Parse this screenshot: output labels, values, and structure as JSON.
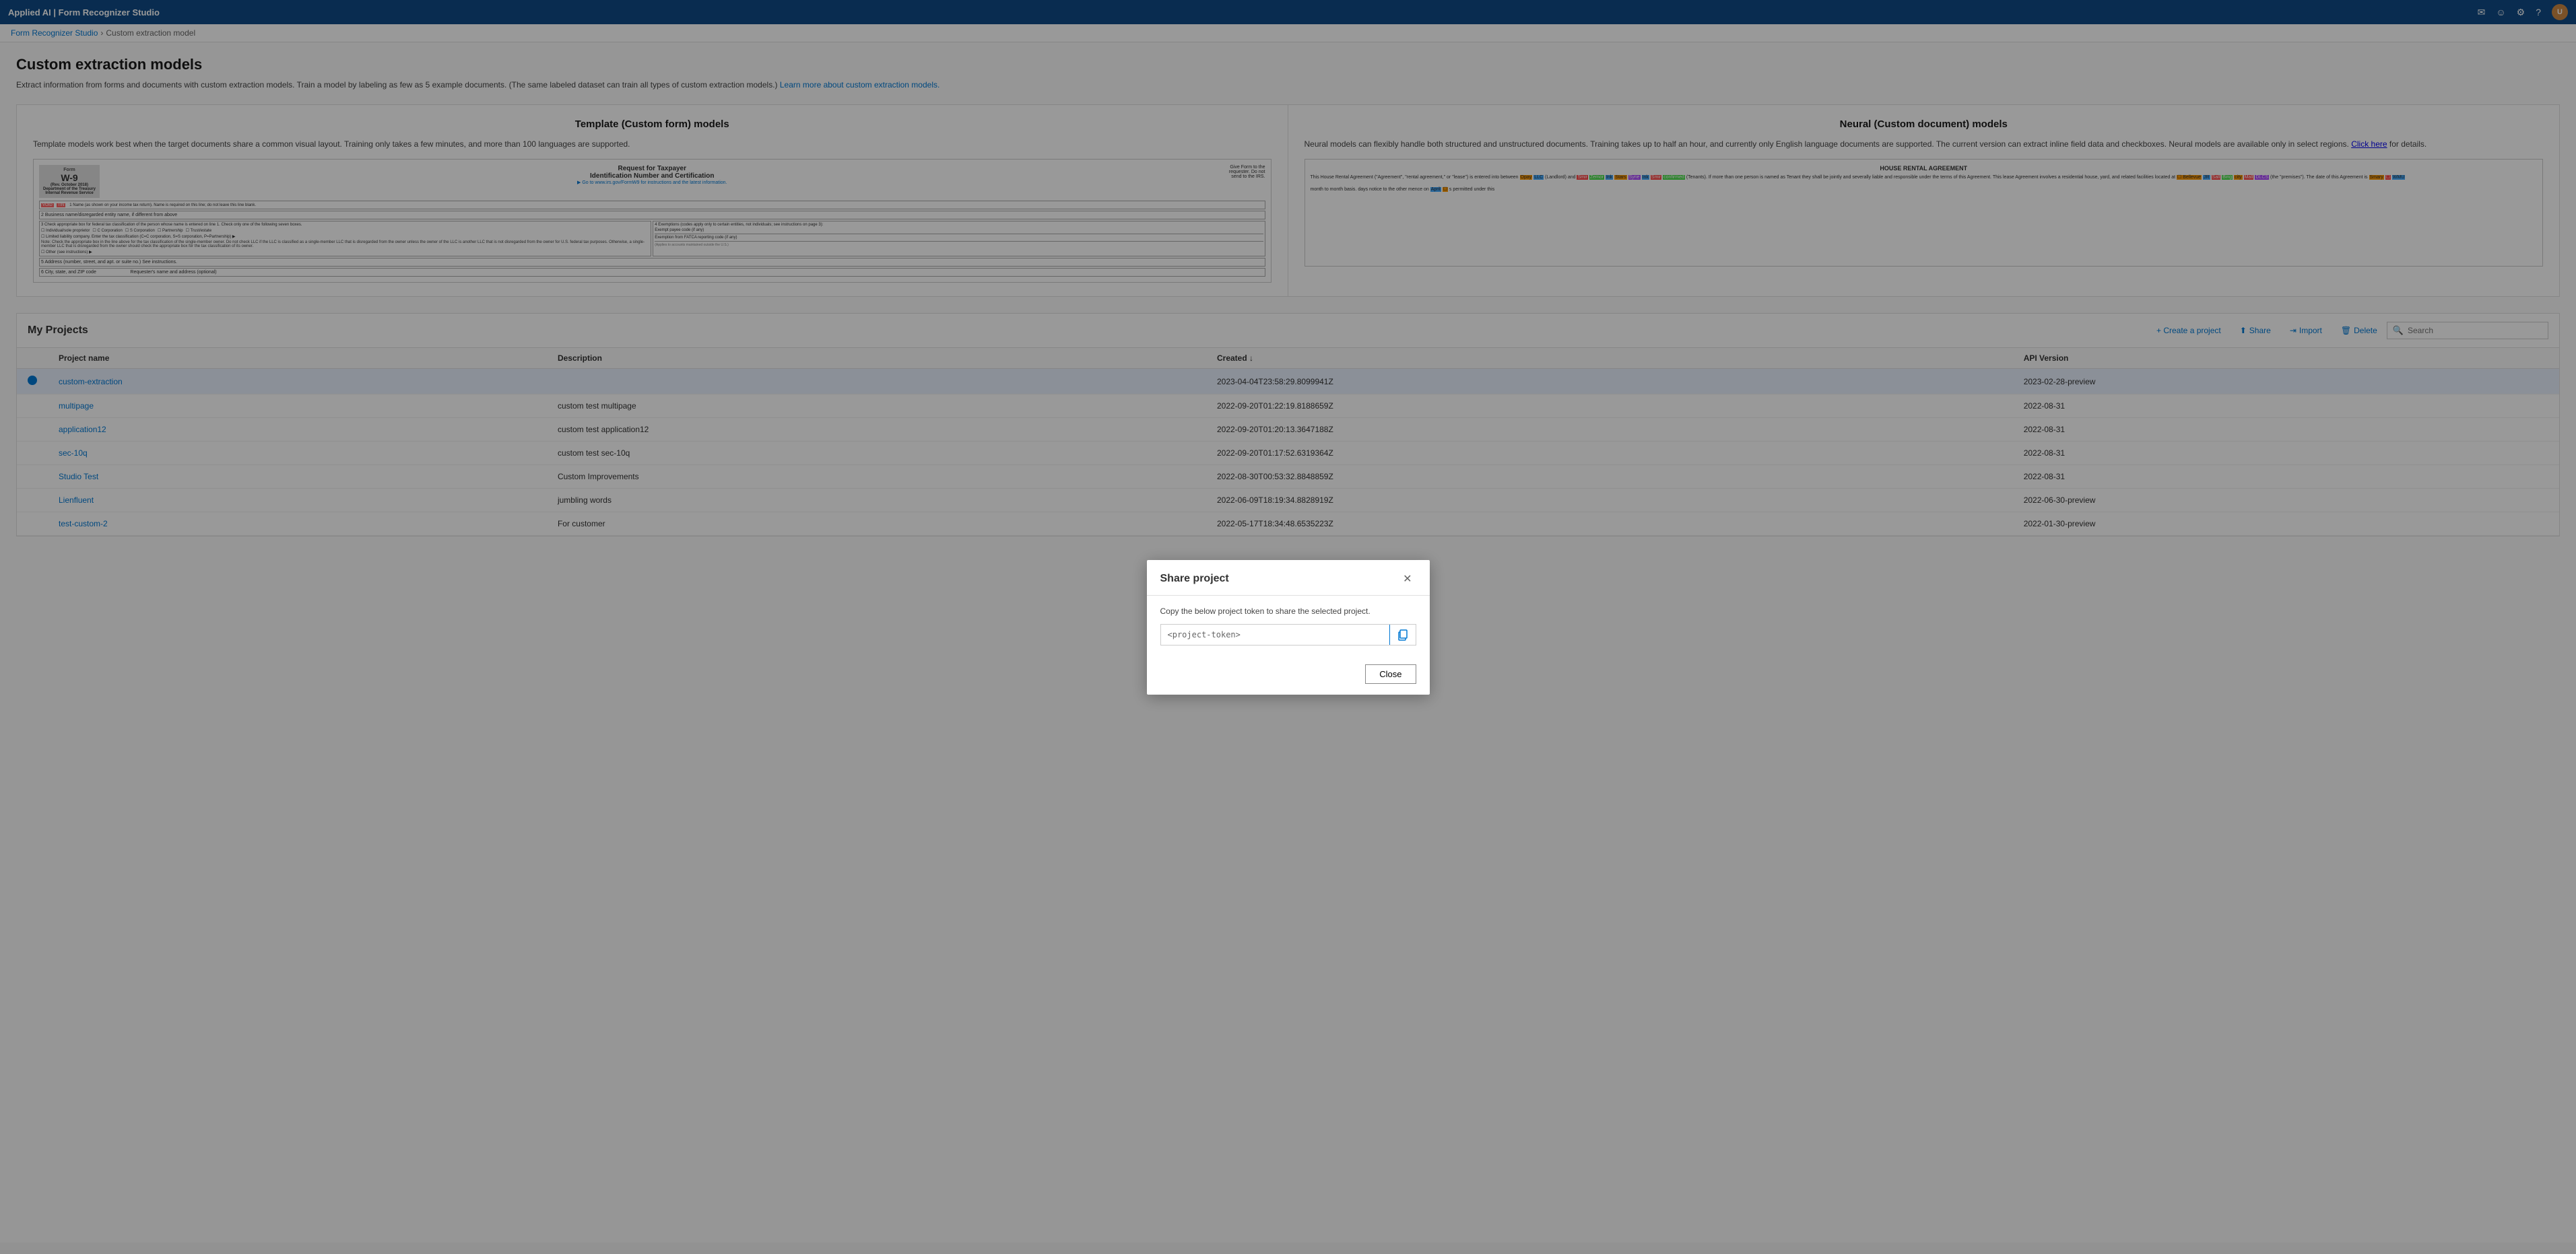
{
  "topbar": {
    "title": "Applied AI | Form Recognizer Studio",
    "icons": [
      "mail-icon",
      "smiley-icon",
      "gear-icon",
      "help-icon",
      "user-icon"
    ]
  },
  "breadcrumb": {
    "parent": "Form Recognizer Studio",
    "current": "Custom extraction model"
  },
  "page": {
    "title": "Custom extraction models",
    "description": "Extract information from forms and documents with custom extraction models. Train a model by labeling as few as 5 example documents. (The same labeled dataset can train all types of custom extraction models.)",
    "learn_more_text": "Learn more about custom extraction models.",
    "learn_more_url": "#"
  },
  "template_col": {
    "title": "Template (Custom form) models",
    "description": "Template models work best when the target documents share a common visual layout. Training only takes a few minutes, and more than 100 languages are supported.",
    "doc_title": "W-9",
    "doc_subtitle": "Request for Taxpayer Identification Number and Certification"
  },
  "neural_col": {
    "title": "Neural (Custom document) models",
    "description": "Neural models can flexibly handle both structured and unstructured documents. Training takes up to half an hour, and currently only English language documents are supported. The current version can extract inline field data and checkboxes. Neural models are available only in select regions.",
    "click_here": "Click here",
    "for_details": "for details.",
    "doc_title": "HOUSE RENTAL AGREEMENT"
  },
  "projects": {
    "title": "My Projects",
    "actions": {
      "create": "+ Create a project",
      "share": "Share",
      "import": "Import",
      "delete": "Delete"
    },
    "search": {
      "placeholder": "Search"
    },
    "table": {
      "columns": [
        "",
        "Project name",
        "Description",
        "Created ↓",
        "API Version"
      ],
      "rows": [
        {
          "indicator": true,
          "name": "custom-extraction",
          "description": "",
          "created": "2023-04-04T23:58:29.8099941Z",
          "api_version": "2023-02-28-preview",
          "selected": true
        },
        {
          "indicator": false,
          "name": "multipage",
          "description": "custom test multipage",
          "created": "2022-09-20T01:22:19.8188659Z",
          "api_version": "2022-08-31",
          "selected": false
        },
        {
          "indicator": false,
          "name": "application12",
          "description": "custom test application12",
          "created": "2022-09-20T01:20:13.3647188Z",
          "api_version": "2022-08-31",
          "selected": false
        },
        {
          "indicator": false,
          "name": "sec-10q",
          "description": "custom test sec-10q",
          "created": "2022-09-20T01:17:52.6319364Z",
          "api_version": "2022-08-31",
          "selected": false
        },
        {
          "indicator": false,
          "name": "Studio Test",
          "description": "Custom Improvements",
          "created": "2022-08-30T00:53:32.8848859Z",
          "api_version": "2022-08-31",
          "selected": false
        },
        {
          "indicator": false,
          "name": "Lienfluent",
          "description": "jumbling words",
          "created": "2022-06-09T18:19:34.8828919Z",
          "api_version": "2022-06-30-preview",
          "selected": false
        },
        {
          "indicator": false,
          "name": "test-custom-2",
          "description": "For customer",
          "created": "2022-05-17T18:34:48.6535223Z",
          "api_version": "2022-01-30-preview",
          "selected": false
        }
      ]
    }
  },
  "modal": {
    "title": "Share project",
    "description": "Copy the below project token to share the selected project.",
    "token_placeholder": "<project-token>",
    "token_value": "<project-token>",
    "copy_button_title": "Copy",
    "close_button": "Close"
  }
}
